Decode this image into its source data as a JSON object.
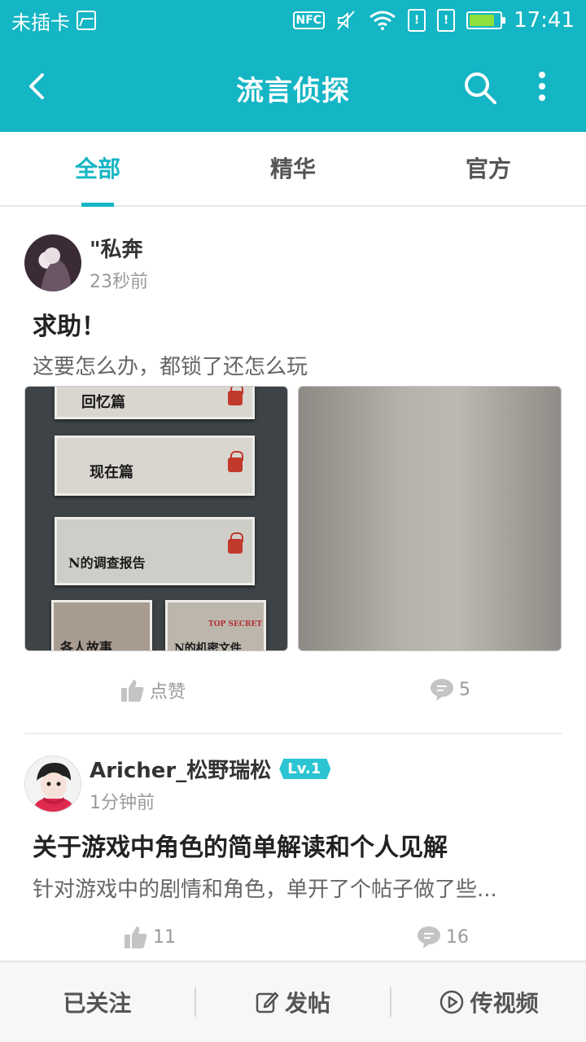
{
  "status_bar": {
    "carrier": "未插卡",
    "nfc": "NFC",
    "time": "17:41",
    "battery_level": 0.8
  },
  "app_bar": {
    "title": "流言侦探"
  },
  "tabs": [
    {
      "label": "全部",
      "active": true
    },
    {
      "label": "精华",
      "active": false
    },
    {
      "label": "官方",
      "active": false
    }
  ],
  "posts": [
    {
      "author": "\"私奔",
      "time": "23秒前",
      "title": "求助！",
      "desc": "这要怎么办，都锁了还怎么玩",
      "images": [
        {
          "cards": [
            "回忆篇",
            "现在篇",
            "N的调查报告",
            "各人故事",
            "N的机密文件"
          ],
          "stamp": "TOP SECRET"
        }
      ],
      "like_label": "点赞",
      "comments": "5"
    },
    {
      "author": "Aricher_松野瑞松",
      "level": "Lv.1",
      "time": "1分钟前",
      "title": "关于游戏中角色的简单解读和个人见解",
      "desc": "针对游戏中的剧情和角色，单开了个帖子做了些...",
      "likes": "11",
      "comments": "16"
    }
  ],
  "bottom_bar": {
    "followed": "已关注",
    "post": "发帖",
    "video": "传视频"
  },
  "colors": {
    "accent": "#14b5c4",
    "level_badge": "#2cc4d2"
  }
}
